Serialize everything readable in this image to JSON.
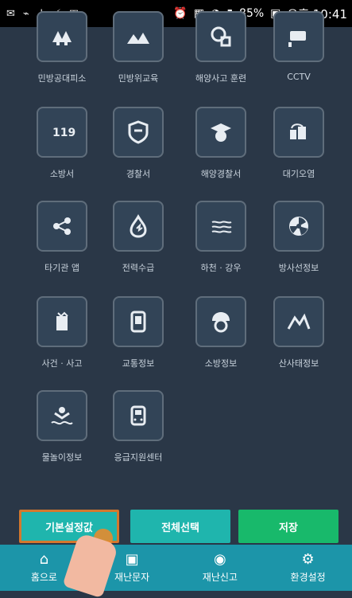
{
  "status": {
    "battery": "85%",
    "time": "오후 10:41"
  },
  "menu": [
    {
      "label": "민방공대피소",
      "icon": "shelter-icon"
    },
    {
      "label": "민방위교육",
      "icon": "mountain-training-icon"
    },
    {
      "label": "해양사고 훈련",
      "icon": "marine-training-icon"
    },
    {
      "label": "CCTV",
      "icon": "cctv-icon"
    },
    {
      "label": "소방서",
      "icon": "fire-119-icon"
    },
    {
      "label": "경찰서",
      "icon": "police-badge-icon"
    },
    {
      "label": "해양경찰서",
      "icon": "coastguard-icon"
    },
    {
      "label": "대기오염",
      "icon": "air-pollution-icon"
    },
    {
      "label": "타기관 앱",
      "icon": "share-icon"
    },
    {
      "label": "전력수급",
      "icon": "power-drop-icon"
    },
    {
      "label": "하천 · 강우",
      "icon": "river-icon"
    },
    {
      "label": "방사선정보",
      "icon": "radiation-icon"
    },
    {
      "label": "사건 · 사고",
      "icon": "incident-icon"
    },
    {
      "label": "교통정보",
      "icon": "traffic-icon"
    },
    {
      "label": "소방정보",
      "icon": "firefighter-icon"
    },
    {
      "label": "산사태정보",
      "icon": "landslide-icon"
    },
    {
      "label": "물놀이정보",
      "icon": "swimming-icon"
    },
    {
      "label": "응급지원센터",
      "icon": "emergency-train-icon"
    }
  ],
  "buttons": {
    "default": "기본설정값",
    "select_all": "전체선택",
    "save": "저장"
  },
  "nav": [
    {
      "label": "홈으로",
      "icon": "home-icon"
    },
    {
      "label": "재난문자",
      "icon": "message-icon"
    },
    {
      "label": "재난신고",
      "icon": "report-icon"
    },
    {
      "label": "환경설정",
      "icon": "settings-icon"
    }
  ]
}
